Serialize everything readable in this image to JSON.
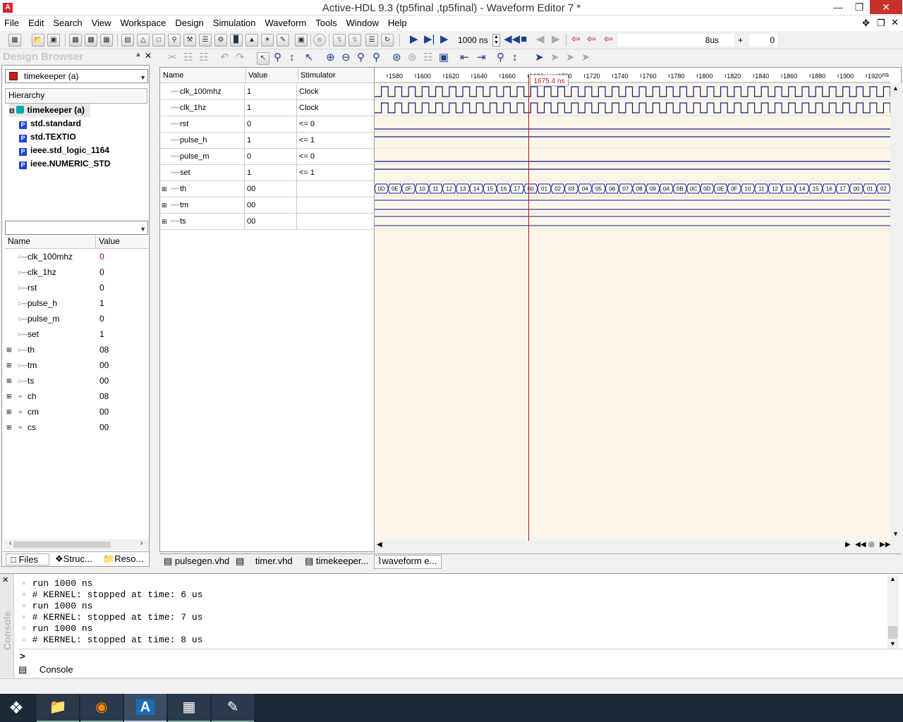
{
  "window": {
    "title": "Active-HDL 9.3 (tp5final ,tp5final) - Waveform Editor 7 *",
    "app_icon": "A"
  },
  "menu": [
    "File",
    "Edit",
    "Search",
    "View",
    "Workspace",
    "Design",
    "Simulation",
    "Waveform",
    "Tools",
    "Window",
    "Help"
  ],
  "toolbar": {
    "run_time": "1000 ns",
    "time_field": "8us",
    "plus": "+",
    "offset_field": "0"
  },
  "design_browser": {
    "title": "Design Browser",
    "top_combo": "timekeeper (a)",
    "hierarchy_header": "Hierarchy",
    "items": [
      {
        "label": "timekeeper (a)",
        "icon": "entity-icon"
      },
      {
        "label": "std.standard",
        "icon": "package-icon"
      },
      {
        "label": "std.TEXTIO",
        "icon": "package-icon"
      },
      {
        "label": "ieee.std_logic_1164",
        "icon": "package-icon"
      },
      {
        "label": "ieee.NUMERIC_STD",
        "icon": "package-icon"
      }
    ],
    "package_letter": "P",
    "signal_headers": {
      "name": "Name",
      "value": "Value"
    },
    "signals": [
      {
        "name": "clk_100mhz",
        "value": "0",
        "expand": false,
        "kind": "port"
      },
      {
        "name": "clk_1hz",
        "value": "0",
        "expand": false,
        "kind": "port"
      },
      {
        "name": "rst",
        "value": "0",
        "expand": false,
        "kind": "port"
      },
      {
        "name": "pulse_h",
        "value": "1",
        "expand": false,
        "kind": "port"
      },
      {
        "name": "pulse_m",
        "value": "0",
        "expand": false,
        "kind": "port"
      },
      {
        "name": "set",
        "value": "1",
        "expand": false,
        "kind": "port"
      },
      {
        "name": "th",
        "value": "08",
        "expand": true,
        "kind": "port"
      },
      {
        "name": "tm",
        "value": "00",
        "expand": true,
        "kind": "port"
      },
      {
        "name": "ts",
        "value": "00",
        "expand": true,
        "kind": "port"
      },
      {
        "name": "ch",
        "value": "08",
        "expand": true,
        "kind": "signal"
      },
      {
        "name": "cm",
        "value": "00",
        "expand": true,
        "kind": "signal"
      },
      {
        "name": "cs",
        "value": "00",
        "expand": true,
        "kind": "signal"
      }
    ],
    "tabs": [
      "Files",
      "Struc...",
      "Reso..."
    ]
  },
  "waveform": {
    "headers": {
      "name": "Name",
      "value": "Value",
      "stimulator": "Stimulator"
    },
    "rows": [
      {
        "name": "clk_100mhz",
        "value": "1",
        "stim": "Clock",
        "expand": false
      },
      {
        "name": "clk_1hz",
        "value": "1",
        "stim": "Clock",
        "expand": false
      },
      {
        "name": "rst",
        "value": "0",
        "stim": "<= 0",
        "expand": false
      },
      {
        "name": "pulse_h",
        "value": "1",
        "stim": "<= 1",
        "expand": false
      },
      {
        "name": "pulse_m",
        "value": "0",
        "stim": "<= 0",
        "expand": false
      },
      {
        "name": "set",
        "value": "1",
        "stim": "<= 1",
        "expand": false
      },
      {
        "name": "th",
        "value": "00",
        "stim": "",
        "expand": true
      },
      {
        "name": "tm",
        "value": "00",
        "stim": "",
        "expand": true
      },
      {
        "name": "ts",
        "value": "00",
        "stim": "",
        "expand": true
      }
    ],
    "ruler_ticks": [
      "1580",
      "1600",
      "1620",
      "1640",
      "1660",
      "1680",
      "1700",
      "1720",
      "1740",
      "1760",
      "1780",
      "1800",
      "1820",
      "1840",
      "1860",
      "1880",
      "1900",
      "1920"
    ],
    "ruler_unit": "ns",
    "cursor_label": "1675.4 ns",
    "cursor_time_ns": 1675.4,
    "time_start_ns": 1566,
    "time_end_ns": 1932,
    "th_bus_values": [
      "0D",
      "0E",
      "0F",
      "10",
      "11",
      "12",
      "13",
      "14",
      "15",
      "16",
      "17",
      "00",
      "01",
      "02",
      "03",
      "04",
      "05",
      "06",
      "07",
      "08",
      "09",
      "0A",
      "0B",
      "0C",
      "0D",
      "0E",
      "0F",
      "10",
      "11",
      "12",
      "13",
      "14",
      "15",
      "16",
      "17",
      "00",
      "01",
      "02"
    ],
    "doc_tabs": [
      "pulsegen.vhd",
      "timer.vhd",
      "timekeeper...",
      "waveform e..."
    ]
  },
  "console": {
    "side_label": "Console",
    "lines": [
      "run 1000 ns",
      "# KERNEL: stopped at time: 6 us",
      "run 1000 ns",
      "# KERNEL: stopped at time: 7 us",
      "run 1000 ns",
      "# KERNEL: stopped at time: 8 us"
    ],
    "prompt": ">",
    "tab": "Console"
  },
  "colors": {
    "wave_bg": "#fbf6e9",
    "wave_line": "#0a1a8a",
    "cursor": "#b4141e",
    "value_red": "#d00000"
  }
}
